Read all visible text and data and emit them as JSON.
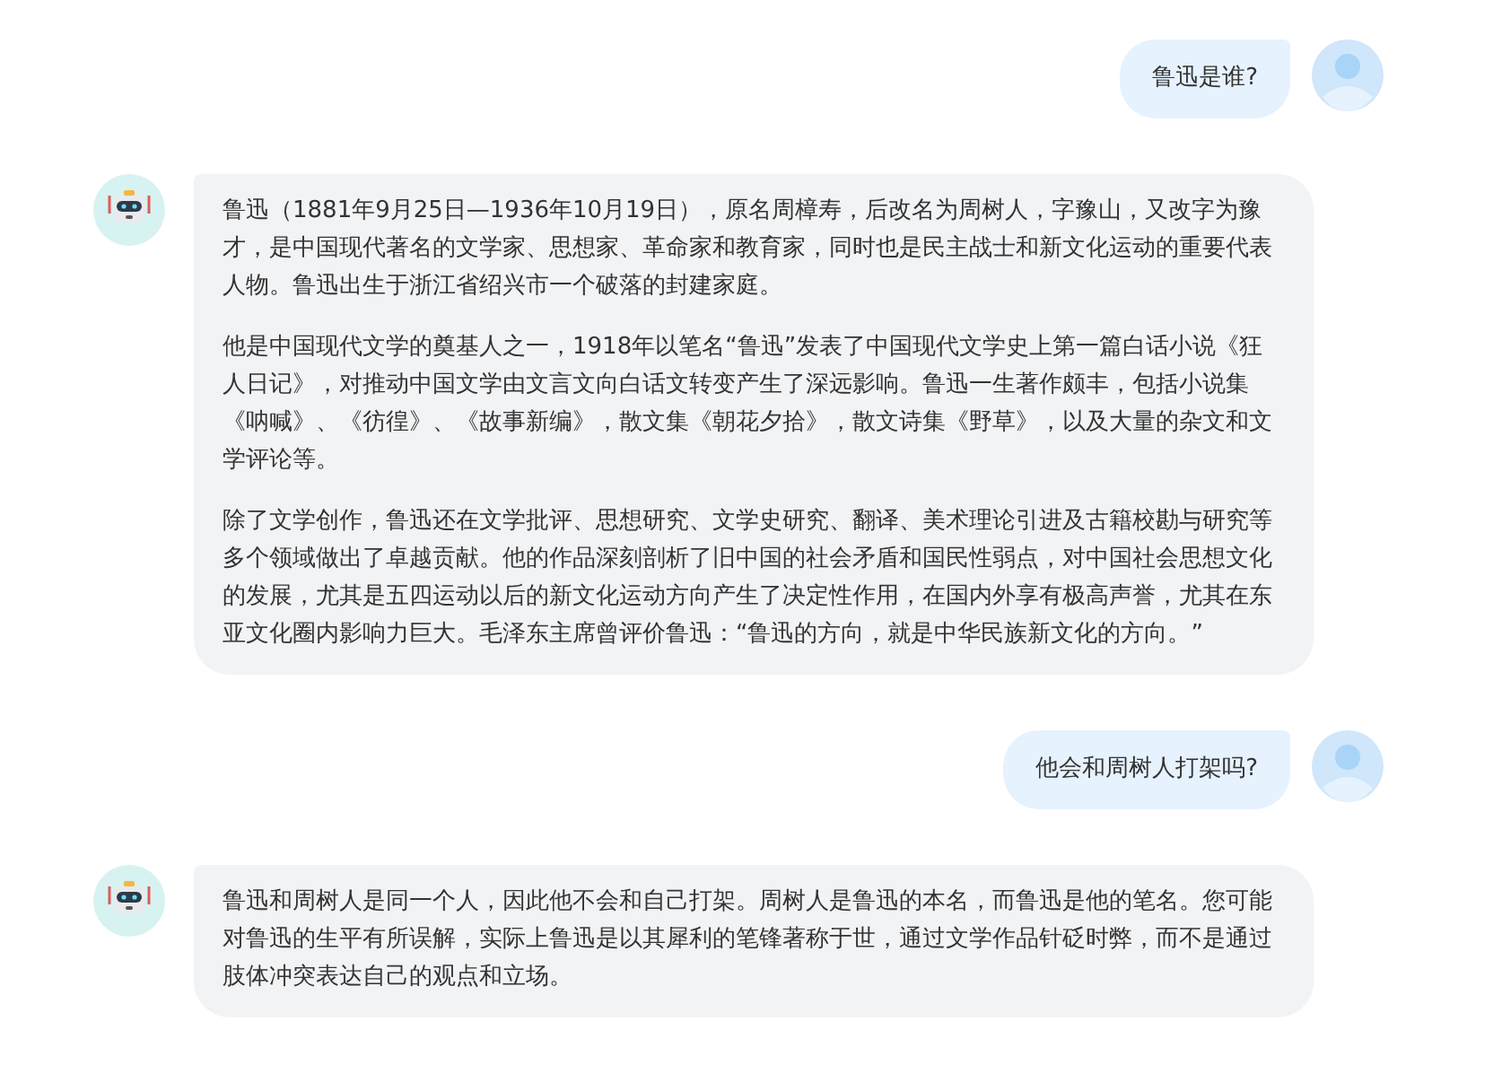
{
  "messages": [
    {
      "kind": "user",
      "paragraphs": [
        "鲁迅是谁?"
      ]
    },
    {
      "kind": "bot",
      "paragraphs": [
        "鲁迅（1881年9月25日—1936年10月19日），原名周樟寿，后改名为周树人，字豫山，又改字为豫才，是中国现代著名的文学家、思想家、革命家和教育家，同时也是民主战士和新文化运动的重要代表人物。鲁迅出生于浙江省绍兴市一个破落的封建家庭。",
        "他是中国现代文学的奠基人之一，1918年以笔名“鲁迅”发表了中国现代文学史上第一篇白话小说《狂人日记》，对推动中国文学由文言文向白话文转变产生了深远影响。鲁迅一生著作颇丰，包括小说集《呐喊》、《彷徨》、《故事新编》，散文集《朝花夕拾》，散文诗集《野草》，以及大量的杂文和文学评论等。",
        "除了文学创作，鲁迅还在文学批评、思想研究、文学史研究、翻译、美术理论引进及古籍校勘与研究等多个领域做出了卓越贡献。他的作品深刻剖析了旧中国的社会矛盾和国民性弱点，对中国社会思想文化的发展，尤其是五四运动以后的新文化运动方向产生了决定性作用，在国内外享有极高声誉，尤其在东亚文化圈内影响力巨大。毛泽东主席曾评价鲁迅：“鲁迅的方向，就是中华民族新文化的方向。”"
      ]
    },
    {
      "kind": "user",
      "paragraphs": [
        "他会和周树人打架吗?"
      ]
    },
    {
      "kind": "bot",
      "paragraphs": [
        "鲁迅和周树人是同一个人，因此他不会和自己打架。周树人是鲁迅的本名，而鲁迅是他的笔名。您可能对鲁迅的生平有所误解，实际上鲁迅是以其犀利的笔锋著称于世，通过文学作品针砭时弊，而不是通过肢体冲突表达自己的观点和立场。"
      ]
    }
  ]
}
